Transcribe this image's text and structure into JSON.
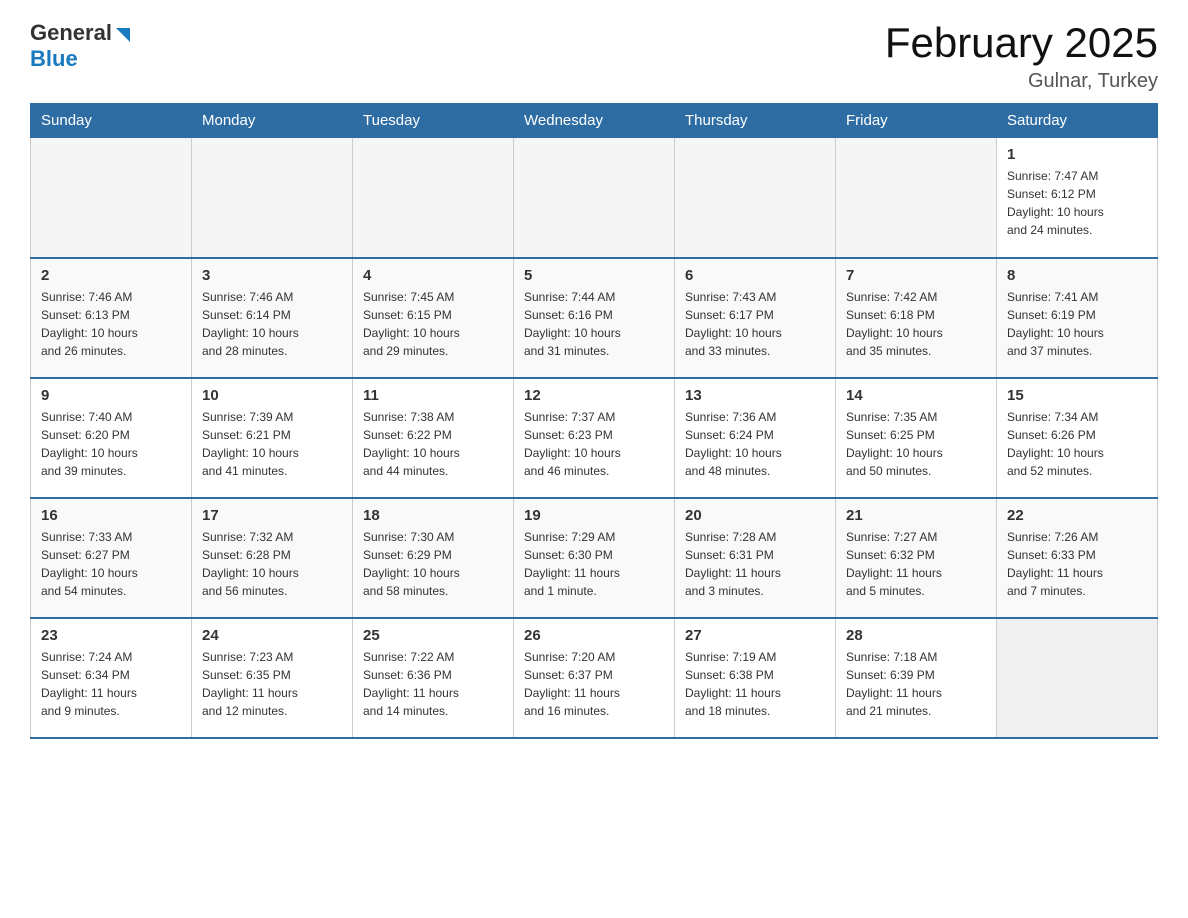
{
  "header": {
    "logo_general": "General",
    "logo_blue": "Blue",
    "title": "February 2025",
    "location": "Gulnar, Turkey"
  },
  "days_of_week": [
    "Sunday",
    "Monday",
    "Tuesday",
    "Wednesday",
    "Thursday",
    "Friday",
    "Saturday"
  ],
  "weeks": [
    {
      "days": [
        {
          "num": "",
          "info": ""
        },
        {
          "num": "",
          "info": ""
        },
        {
          "num": "",
          "info": ""
        },
        {
          "num": "",
          "info": ""
        },
        {
          "num": "",
          "info": ""
        },
        {
          "num": "",
          "info": ""
        },
        {
          "num": "1",
          "info": "Sunrise: 7:47 AM\nSunset: 6:12 PM\nDaylight: 10 hours\nand 24 minutes."
        }
      ]
    },
    {
      "days": [
        {
          "num": "2",
          "info": "Sunrise: 7:46 AM\nSunset: 6:13 PM\nDaylight: 10 hours\nand 26 minutes."
        },
        {
          "num": "3",
          "info": "Sunrise: 7:46 AM\nSunset: 6:14 PM\nDaylight: 10 hours\nand 28 minutes."
        },
        {
          "num": "4",
          "info": "Sunrise: 7:45 AM\nSunset: 6:15 PM\nDaylight: 10 hours\nand 29 minutes."
        },
        {
          "num": "5",
          "info": "Sunrise: 7:44 AM\nSunset: 6:16 PM\nDaylight: 10 hours\nand 31 minutes."
        },
        {
          "num": "6",
          "info": "Sunrise: 7:43 AM\nSunset: 6:17 PM\nDaylight: 10 hours\nand 33 minutes."
        },
        {
          "num": "7",
          "info": "Sunrise: 7:42 AM\nSunset: 6:18 PM\nDaylight: 10 hours\nand 35 minutes."
        },
        {
          "num": "8",
          "info": "Sunrise: 7:41 AM\nSunset: 6:19 PM\nDaylight: 10 hours\nand 37 minutes."
        }
      ]
    },
    {
      "days": [
        {
          "num": "9",
          "info": "Sunrise: 7:40 AM\nSunset: 6:20 PM\nDaylight: 10 hours\nand 39 minutes."
        },
        {
          "num": "10",
          "info": "Sunrise: 7:39 AM\nSunset: 6:21 PM\nDaylight: 10 hours\nand 41 minutes."
        },
        {
          "num": "11",
          "info": "Sunrise: 7:38 AM\nSunset: 6:22 PM\nDaylight: 10 hours\nand 44 minutes."
        },
        {
          "num": "12",
          "info": "Sunrise: 7:37 AM\nSunset: 6:23 PM\nDaylight: 10 hours\nand 46 minutes."
        },
        {
          "num": "13",
          "info": "Sunrise: 7:36 AM\nSunset: 6:24 PM\nDaylight: 10 hours\nand 48 minutes."
        },
        {
          "num": "14",
          "info": "Sunrise: 7:35 AM\nSunset: 6:25 PM\nDaylight: 10 hours\nand 50 minutes."
        },
        {
          "num": "15",
          "info": "Sunrise: 7:34 AM\nSunset: 6:26 PM\nDaylight: 10 hours\nand 52 minutes."
        }
      ]
    },
    {
      "days": [
        {
          "num": "16",
          "info": "Sunrise: 7:33 AM\nSunset: 6:27 PM\nDaylight: 10 hours\nand 54 minutes."
        },
        {
          "num": "17",
          "info": "Sunrise: 7:32 AM\nSunset: 6:28 PM\nDaylight: 10 hours\nand 56 minutes."
        },
        {
          "num": "18",
          "info": "Sunrise: 7:30 AM\nSunset: 6:29 PM\nDaylight: 10 hours\nand 58 minutes."
        },
        {
          "num": "19",
          "info": "Sunrise: 7:29 AM\nSunset: 6:30 PM\nDaylight: 11 hours\nand 1 minute."
        },
        {
          "num": "20",
          "info": "Sunrise: 7:28 AM\nSunset: 6:31 PM\nDaylight: 11 hours\nand 3 minutes."
        },
        {
          "num": "21",
          "info": "Sunrise: 7:27 AM\nSunset: 6:32 PM\nDaylight: 11 hours\nand 5 minutes."
        },
        {
          "num": "22",
          "info": "Sunrise: 7:26 AM\nSunset: 6:33 PM\nDaylight: 11 hours\nand 7 minutes."
        }
      ]
    },
    {
      "days": [
        {
          "num": "23",
          "info": "Sunrise: 7:24 AM\nSunset: 6:34 PM\nDaylight: 11 hours\nand 9 minutes."
        },
        {
          "num": "24",
          "info": "Sunrise: 7:23 AM\nSunset: 6:35 PM\nDaylight: 11 hours\nand 12 minutes."
        },
        {
          "num": "25",
          "info": "Sunrise: 7:22 AM\nSunset: 6:36 PM\nDaylight: 11 hours\nand 14 minutes."
        },
        {
          "num": "26",
          "info": "Sunrise: 7:20 AM\nSunset: 6:37 PM\nDaylight: 11 hours\nand 16 minutes."
        },
        {
          "num": "27",
          "info": "Sunrise: 7:19 AM\nSunset: 6:38 PM\nDaylight: 11 hours\nand 18 minutes."
        },
        {
          "num": "28",
          "info": "Sunrise: 7:18 AM\nSunset: 6:39 PM\nDaylight: 11 hours\nand 21 minutes."
        },
        {
          "num": "",
          "info": ""
        }
      ]
    }
  ]
}
